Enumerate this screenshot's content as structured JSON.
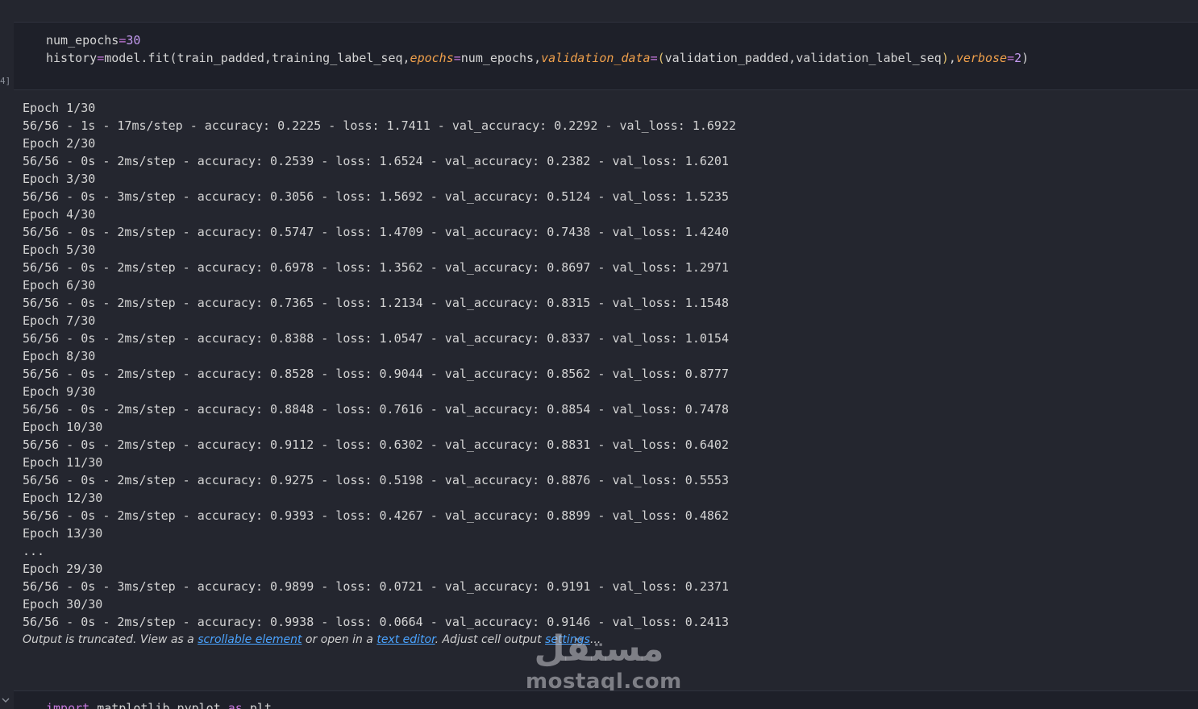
{
  "cell": {
    "exec_count": "4]",
    "line1": {
      "var": "num_epochs",
      "op": "=",
      "value": "30"
    },
    "line2": {
      "lhs": "history",
      "op": "=",
      "call": "model.fit(",
      "arg1": "train_padded,training_label_seq,",
      "kw1": "epochs",
      "kw1_eq": "=",
      "kw1_val": "num_epochs,",
      "kw2": "validation_data",
      "kw2_eq": "=",
      "paren_open": "(",
      "kw2_val": "validation_padded,validation_label_seq",
      "paren_close": ")",
      "comma": ",",
      "kw3": "verbose",
      "kw3_eq": "=",
      "kw3_val": "2",
      "end": ")"
    }
  },
  "output_lines": [
    "Epoch 1/30",
    "56/56 - 1s - 17ms/step - accuracy: 0.2225 - loss: 1.7411 - val_accuracy: 0.2292 - val_loss: 1.6922",
    "Epoch 2/30",
    "56/56 - 0s - 2ms/step - accuracy: 0.2539 - loss: 1.6524 - val_accuracy: 0.2382 - val_loss: 1.6201",
    "Epoch 3/30",
    "56/56 - 0s - 3ms/step - accuracy: 0.3056 - loss: 1.5692 - val_accuracy: 0.5124 - val_loss: 1.5235",
    "Epoch 4/30",
    "56/56 - 0s - 2ms/step - accuracy: 0.5747 - loss: 1.4709 - val_accuracy: 0.7438 - val_loss: 1.4240",
    "Epoch 5/30",
    "56/56 - 0s - 2ms/step - accuracy: 0.6978 - loss: 1.3562 - val_accuracy: 0.8697 - val_loss: 1.2971",
    "Epoch 6/30",
    "56/56 - 0s - 2ms/step - accuracy: 0.7365 - loss: 1.2134 - val_accuracy: 0.8315 - val_loss: 1.1548",
    "Epoch 7/30",
    "56/56 - 0s - 2ms/step - accuracy: 0.8388 - loss: 1.0547 - val_accuracy: 0.8337 - val_loss: 1.0154",
    "Epoch 8/30",
    "56/56 - 0s - 2ms/step - accuracy: 0.8528 - loss: 0.9044 - val_accuracy: 0.8562 - val_loss: 0.8777",
    "Epoch 9/30",
    "56/56 - 0s - 2ms/step - accuracy: 0.8848 - loss: 0.7616 - val_accuracy: 0.8854 - val_loss: 0.7478",
    "Epoch 10/30",
    "56/56 - 0s - 2ms/step - accuracy: 0.9112 - loss: 0.6302 - val_accuracy: 0.8831 - val_loss: 0.6402",
    "Epoch 11/30",
    "56/56 - 0s - 2ms/step - accuracy: 0.9275 - loss: 0.5198 - val_accuracy: 0.8876 - val_loss: 0.5553",
    "Epoch 12/30",
    "56/56 - 0s - 2ms/step - accuracy: 0.9393 - loss: 0.4267 - val_accuracy: 0.8899 - val_loss: 0.4862",
    "Epoch 13/30",
    "...",
    "Epoch 29/30",
    "56/56 - 0s - 3ms/step - accuracy: 0.9899 - loss: 0.0721 - val_accuracy: 0.9191 - val_loss: 0.2371",
    "Epoch 30/30",
    "56/56 - 0s - 2ms/step - accuracy: 0.9938 - loss: 0.0664 - val_accuracy: 0.9146 - val_loss: 0.2413"
  ],
  "truncation": {
    "prefix": "Output is truncated. View as a ",
    "link1": "scrollable element",
    "mid1": " or open in a ",
    "link2": "text editor",
    "mid2": ". Adjust cell output ",
    "link3": "settings",
    "suffix": "..."
  },
  "watermark": {
    "arabic": "مستقل",
    "latin": "mostaql.com"
  },
  "next_cell": {
    "kw_import": "import",
    "module": " matplotlib.pyplot ",
    "kw_as": "as",
    "alias": " plt"
  },
  "colors": {
    "background": "#24262f",
    "cell_background": "#1e2029",
    "link": "#4aa3ff",
    "keyword_arg": "#f0a04b",
    "operator": "#c678dd"
  },
  "icons": {
    "collapse": "chevron-down-icon"
  }
}
